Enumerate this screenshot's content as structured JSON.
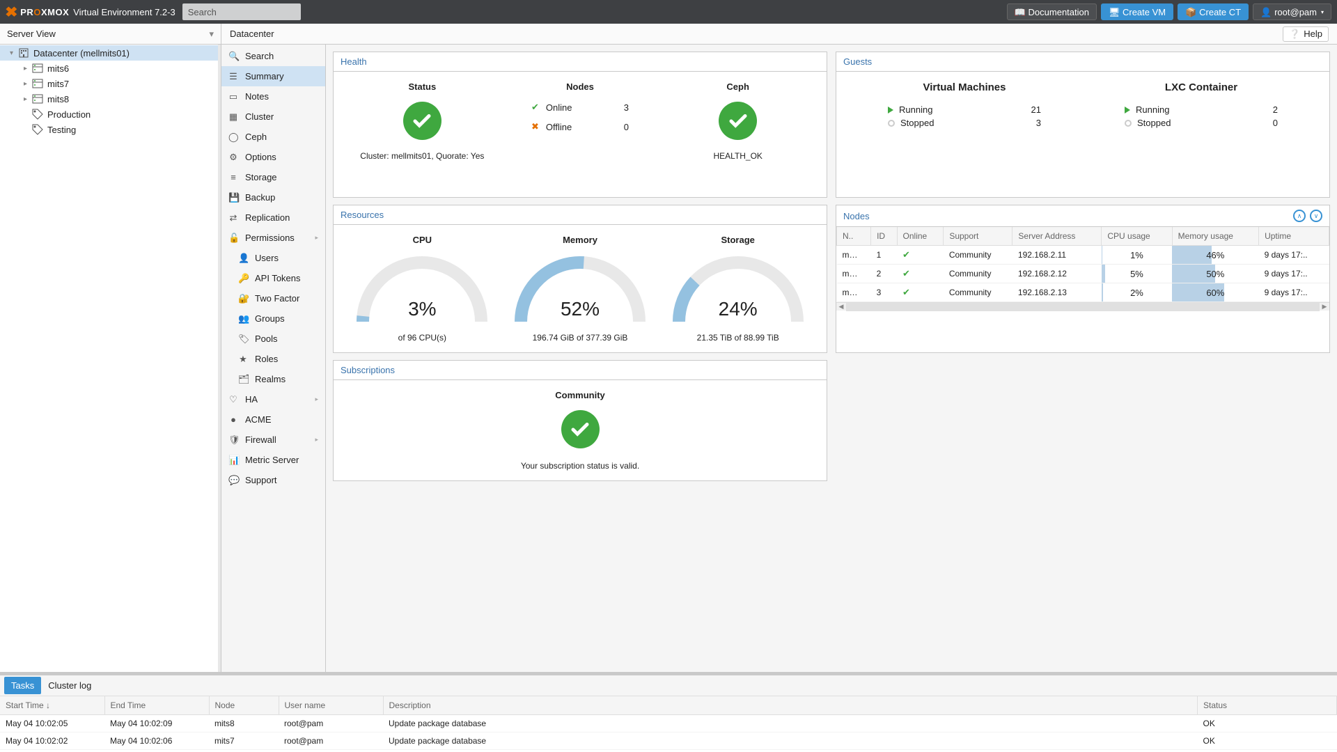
{
  "header": {
    "product": {
      "pre": "PR",
      "mid": "O",
      "post": "XMOX"
    },
    "version": "Virtual Environment 7.2-3",
    "search_placeholder": "Search",
    "documentation": "Documentation",
    "create_vm": "Create VM",
    "create_ct": "Create CT",
    "user": "root@pam"
  },
  "tree": {
    "view": "Server View",
    "root": "Datacenter (mellmits01)",
    "nodes": [
      "mits6",
      "mits7",
      "mits8"
    ],
    "pools": [
      "Production",
      "Testing"
    ]
  },
  "crumb": {
    "title": "Datacenter",
    "help": "Help"
  },
  "sidebar": {
    "items": [
      {
        "icon": "search",
        "label": "Search"
      },
      {
        "icon": "list",
        "label": "Summary",
        "sel": true
      },
      {
        "icon": "note",
        "label": "Notes"
      },
      {
        "icon": "cluster",
        "label": "Cluster"
      },
      {
        "icon": "ceph",
        "label": "Ceph"
      },
      {
        "icon": "gear",
        "label": "Options"
      },
      {
        "icon": "db",
        "label": "Storage"
      },
      {
        "icon": "floppy",
        "label": "Backup"
      },
      {
        "icon": "repl",
        "label": "Replication"
      },
      {
        "icon": "lock",
        "label": "Permissions",
        "expand": true
      },
      {
        "icon": "user",
        "label": "Users",
        "sub": true
      },
      {
        "icon": "key",
        "label": "API Tokens",
        "sub": true
      },
      {
        "icon": "2fa",
        "label": "Two Factor",
        "sub": true
      },
      {
        "icon": "group",
        "label": "Groups",
        "sub": true
      },
      {
        "icon": "tag",
        "label": "Pools",
        "sub": true
      },
      {
        "icon": "role",
        "label": "Roles",
        "sub": true
      },
      {
        "icon": "realm",
        "label": "Realms",
        "sub": true
      },
      {
        "icon": "heart",
        "label": "HA",
        "expand": true
      },
      {
        "icon": "acme",
        "label": "ACME"
      },
      {
        "icon": "fire",
        "label": "Firewall",
        "expand": true
      },
      {
        "icon": "chart",
        "label": "Metric Server"
      },
      {
        "icon": "support",
        "label": "Support"
      }
    ]
  },
  "health": {
    "title": "Health",
    "status_h": "Status",
    "cluster_line": "Cluster: mellmits01, Quorate: Yes",
    "nodes_h": "Nodes",
    "online": "Online",
    "online_n": "3",
    "offline": "Offline",
    "offline_n": "0",
    "ceph_h": "Ceph",
    "ceph_status": "HEALTH_OK"
  },
  "guests": {
    "title": "Guests",
    "vm_h": "Virtual Machines",
    "lxc_h": "LXC Container",
    "running": "Running",
    "stopped": "Stopped",
    "vm_run": "21",
    "vm_stop": "3",
    "lxc_run": "2",
    "lxc_stop": "0"
  },
  "resources": {
    "title": "Resources",
    "cpu": {
      "h": "CPU",
      "pct": "3%",
      "sub": "of 96 CPU(s)",
      "val": 3
    },
    "mem": {
      "h": "Memory",
      "pct": "52%",
      "sub": "196.74 GiB of 377.39 GiB",
      "val": 52
    },
    "sto": {
      "h": "Storage",
      "pct": "24%",
      "sub": "21.35 TiB of 88.99 TiB",
      "val": 24
    }
  },
  "nodes": {
    "title": "Nodes",
    "cols": [
      "N..",
      "ID",
      "Online",
      "Support",
      "Server Address",
      "CPU usage",
      "Memory usage",
      "Uptime"
    ],
    "rows": [
      {
        "n": "m…",
        "id": "1",
        "online": true,
        "support": "Community",
        "addr": "192.168.2.11",
        "cpu": 1,
        "cpu_l": "1%",
        "mem": 46,
        "mem_l": "46%",
        "up": "9 days 17:.."
      },
      {
        "n": "m…",
        "id": "2",
        "online": true,
        "support": "Community",
        "addr": "192.168.2.12",
        "cpu": 5,
        "cpu_l": "5%",
        "mem": 50,
        "mem_l": "50%",
        "up": "9 days 17:.."
      },
      {
        "n": "m…",
        "id": "3",
        "online": true,
        "support": "Community",
        "addr": "192.168.2.13",
        "cpu": 2,
        "cpu_l": "2%",
        "mem": 60,
        "mem_l": "60%",
        "up": "9 days 17:.."
      }
    ]
  },
  "subs": {
    "title": "Subscriptions",
    "level": "Community",
    "msg": "Your subscription status is valid."
  },
  "log": {
    "tabs": [
      "Tasks",
      "Cluster log"
    ],
    "cols": [
      "Start Time ↓",
      "End Time",
      "Node",
      "User name",
      "Description",
      "Status"
    ],
    "rows": [
      {
        "st": "May 04 10:02:05",
        "et": "May 04 10:02:09",
        "node": "mits8",
        "user": "root@pam",
        "desc": "Update package database",
        "status": "OK"
      },
      {
        "st": "May 04 10:02:02",
        "et": "May 04 10:02:06",
        "node": "mits7",
        "user": "root@pam",
        "desc": "Update package database",
        "status": "OK"
      }
    ]
  }
}
